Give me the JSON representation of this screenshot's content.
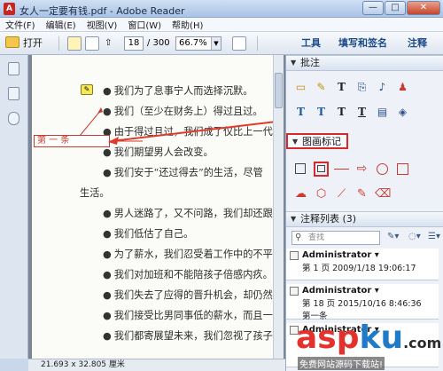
{
  "window": {
    "title": "女人一定要有钱.pdf - Adobe Reader",
    "app_icon": "A",
    "minimize_label": "—",
    "maximize_label": "□",
    "close_label": "✕"
  },
  "menu": [
    "文件(F)",
    "编辑(E)",
    "视图(V)",
    "窗口(W)",
    "帮助(H)"
  ],
  "toolbar": {
    "open_label": "打开",
    "page_current": "18",
    "page_total": "/ 300",
    "zoom": "66.7%",
    "tools_label": "工具",
    "fill_sign_label": "填写和签名",
    "comment_label": "注释"
  },
  "document": {
    "lines": [
      "我们为了息事宁人而选择沉默。",
      "我们（至少在财务上）得过且过。",
      "由于得过且过，我们成了仅比上一代的女",
      "我们期望男人会改变。",
      "我们安于“还过得去”的生活，尽管",
      "生活。",
      "男人迷路了，又不问路，我们却还跟",
      "我们低估了自己。",
      "为了薪水，我们忍受着工作中的不平",
      "我们对加班和不能陪孩子倍感内疚。",
      "我们失去了应得的晋升机会，却仍然",
      "我们接受比男同事低的薪水，而且一",
      "我们都寄展望未来，我们忽视了孩子的"
    ],
    "text_annotation": "第 一 条"
  },
  "status": {
    "page_size": "21.693 x 32.805 厘米"
  },
  "panel": {
    "section_annotations": "批注",
    "section_drawing": "图画标记",
    "section_list": "注释列表 (3)",
    "search_placeholder": "查找",
    "comments": [
      {
        "author": "Administrator",
        "meta": "第 1 页  2009/1/18 19:06:17",
        "body": ""
      },
      {
        "author": "Administrator",
        "meta": "第 18 页  2015/10/16 8:46:36",
        "body": "第一条"
      },
      {
        "author": "Administrator",
        "meta": "",
        "body": ""
      }
    ]
  },
  "watermark": {
    "brand_a": "asp",
    "brand_b": "ku",
    "brand_c": ".com",
    "sub": "免费网站源码下载站!"
  },
  "colors": {
    "accent_red": "#d62a2a",
    "link_blue": "#1a4a8a"
  }
}
